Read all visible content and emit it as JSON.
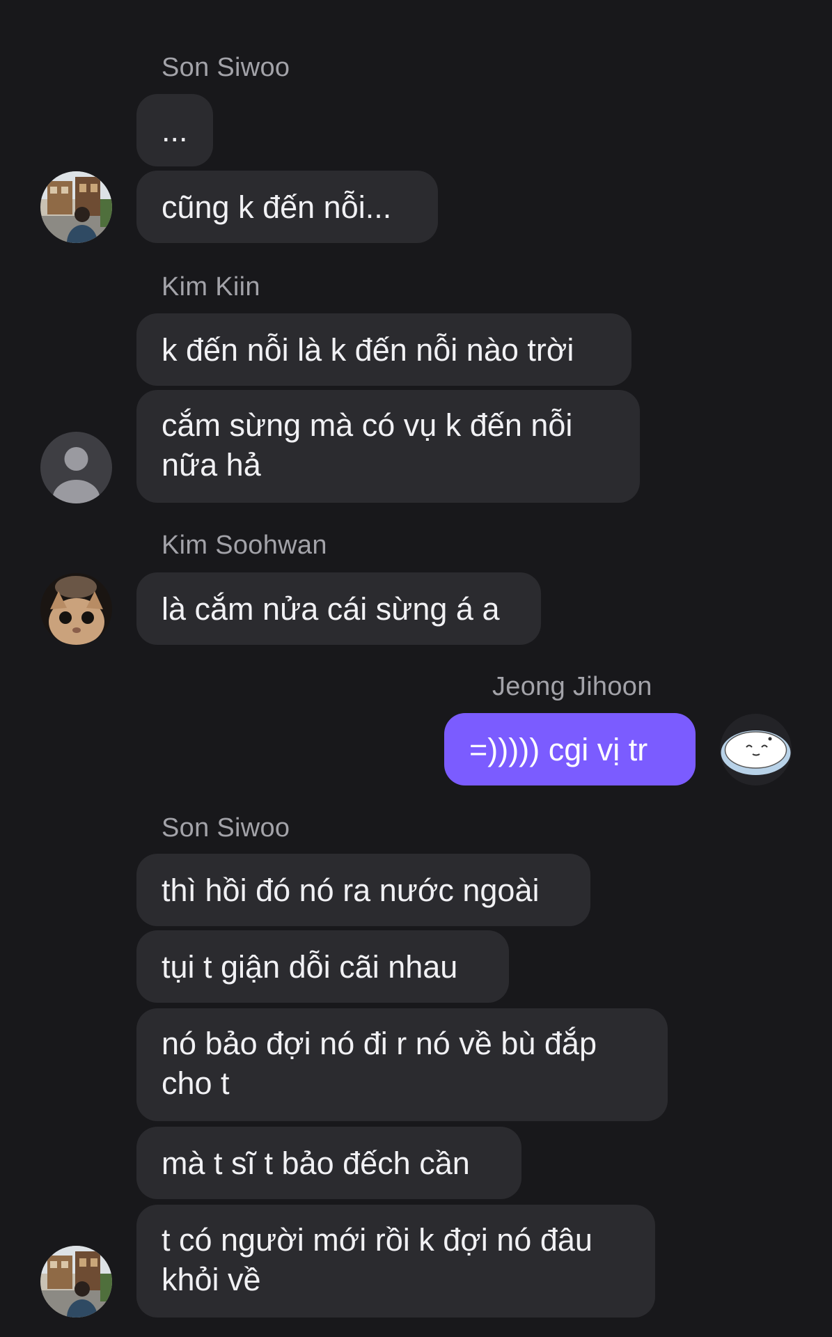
{
  "conversation": {
    "groups": [
      {
        "sender": "Son Siwoo",
        "avatar_icon": "photo-avatar-street-icon",
        "messages": [
          "...",
          "cũng k đến nỗi..."
        ]
      },
      {
        "sender": "Kim Kiin",
        "avatar_icon": "default-person-avatar-icon",
        "messages": [
          "k đến nỗi là k đến nỗi nào trời",
          "cắm sừng mà có vụ k đến nỗi nữa hả"
        ]
      },
      {
        "sender": "Kim Soohwan",
        "avatar_icon": "cat-photo-avatar-icon",
        "messages": [
          "là cắm nửa cái sừng á a"
        ]
      },
      {
        "sender": "Jeong Jihoon",
        "avatar_icon": "sticker-avatar-icon",
        "messages": [
          "=))))) cgi vị tr"
        ]
      },
      {
        "sender": "Son Siwoo",
        "avatar_icon": "photo-avatar-street-icon",
        "messages": [
          "thì hồi đó nó ra nước ngoài",
          "tụi t giận dỗi cãi nhau",
          "nó bảo đợi nó đi r nó về bù đắp cho t",
          "mà t sĩ t bảo đếch cần",
          "t có người mới rồi k đợi nó đâu khỏi về"
        ]
      }
    ]
  },
  "colors": {
    "background": "#18181b",
    "bubble": "#2b2b2f",
    "own_bubble": "#7b5cff",
    "sender_text": "#a3a3a9"
  }
}
